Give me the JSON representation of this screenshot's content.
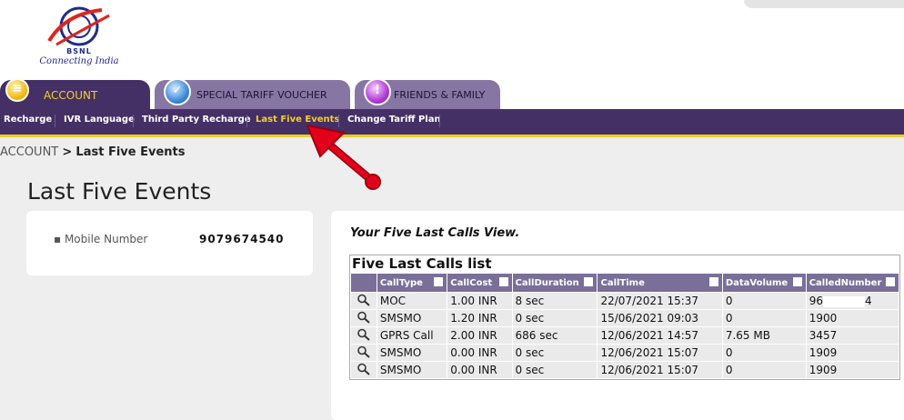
{
  "brand": {
    "name": "BSNL",
    "tagline": "Connecting India"
  },
  "tabs": [
    {
      "label": "ACCOUNT",
      "icon": "account-icon",
      "active": true
    },
    {
      "label": "SPECIAL TARIFF VOUCHER",
      "icon": "voucher-icon",
      "active": false
    },
    {
      "label": "FRIENDS & FAMILY",
      "icon": "friends-family-icon",
      "active": false
    }
  ],
  "subnav": [
    {
      "label": "Recharge",
      "active": false
    },
    {
      "label": "IVR Language",
      "active": false
    },
    {
      "label": "Third Party Recharge",
      "active": false
    },
    {
      "label": "Last Five Events",
      "active": true
    },
    {
      "label": "Change Tariff Plan",
      "active": false
    }
  ],
  "breadcrumb": {
    "parent": "ACCOUNT",
    "separator": ">",
    "current": "Last Five Events"
  },
  "page": {
    "title": "Last Five Events"
  },
  "info": {
    "mobile_label": "Mobile Number",
    "mobile_value": "9079674540"
  },
  "calls": {
    "subtitle": "Your Five Last Calls View.",
    "caption": "Five Last Calls list",
    "columns": [
      "CallType",
      "CallCost",
      "CallDuration",
      "CallTime",
      "DataVolume",
      "CalledNumber"
    ],
    "rows": [
      {
        "type": "MOC",
        "cost": "1.00 INR",
        "duration": "8 sec",
        "time": "22/07/2021 15:37",
        "volume": "0",
        "number": "96",
        "number_tail": "4"
      },
      {
        "type": "SMSMO",
        "cost": "1.20 INR",
        "duration": "0 sec",
        "time": "15/06/2021 09:03",
        "volume": "0",
        "number": "1900",
        "number_tail": ""
      },
      {
        "type": "GPRS Call",
        "cost": "2.00 INR",
        "duration": "686 sec",
        "time": "12/06/2021 14:57",
        "volume": "7.65 MB",
        "number": "3457",
        "number_tail": ""
      },
      {
        "type": "SMSMO",
        "cost": "0.00 INR",
        "duration": "0 sec",
        "time": "12/06/2021 15:07",
        "volume": "0",
        "number": "1909",
        "number_tail": ""
      },
      {
        "type": "SMSMO",
        "cost": "0.00 INR",
        "duration": "0 sec",
        "time": "12/06/2021 15:07",
        "volume": "0",
        "number": "1909",
        "number_tail": ""
      }
    ]
  },
  "colors": {
    "nav_purple": "#453065",
    "tab_purple": "#8776a4",
    "accent_yellow": "#f4cf22",
    "annotation_red": "#e3001b"
  }
}
